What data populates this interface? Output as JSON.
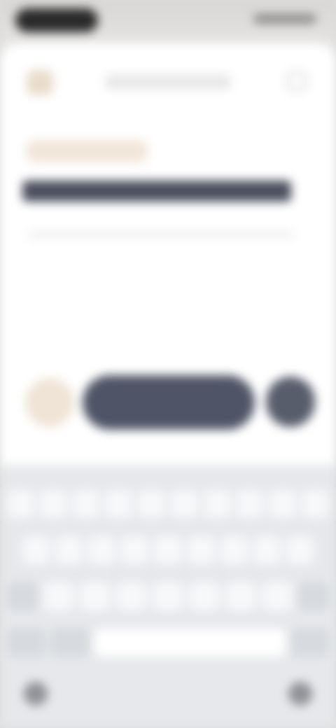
{
  "status_bar": {},
  "header": {
    "title": ""
  },
  "content": {
    "chip": "",
    "headline": "",
    "subline": ""
  },
  "actions": {
    "primary_label": ""
  },
  "keyboard": {
    "row1": [
      "",
      "",
      "",
      "",
      "",
      "",
      "",
      "",
      "",
      ""
    ],
    "row2": [
      "",
      "",
      "",
      "",
      "",
      "",
      "",
      "",
      ""
    ],
    "row3": [
      "",
      "",
      "",
      "",
      "",
      "",
      "",
      "",
      ""
    ],
    "row4": {
      "mode": "",
      "emoji": "",
      "space": "",
      "return": ""
    }
  },
  "colors": {
    "accent": "#4f5566",
    "chip_bg": "#f1e6d9",
    "sheet_bg": "#ffffff",
    "keyboard_bg": "#e6e8eb"
  },
  "icons": [
    "close-icon",
    "menu-icon",
    "attach-icon",
    "send-icon",
    "globe-icon",
    "mic-icon"
  ]
}
